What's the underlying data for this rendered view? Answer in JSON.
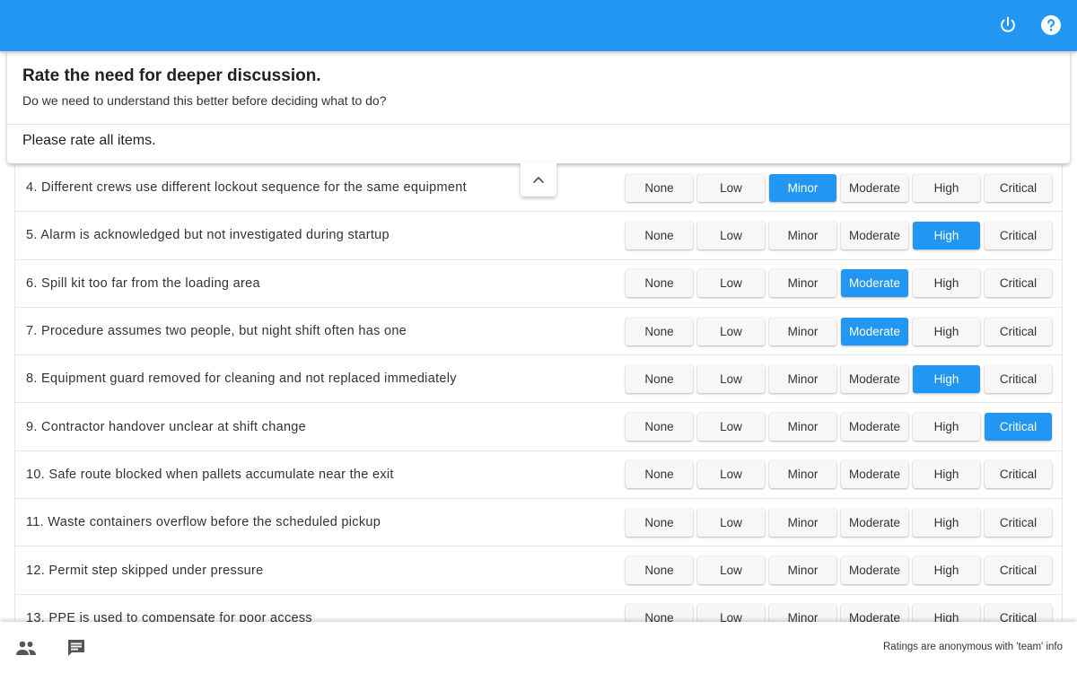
{
  "header": {
    "title": "Rate the need for deeper discussion.",
    "subtitle": "Do we need to understand this better before deciding what to do?",
    "notice": "Please rate all items."
  },
  "topbar": {
    "icons": [
      "power-icon",
      "help-icon"
    ]
  },
  "options": [
    "None",
    "Low",
    "Minor",
    "Moderate",
    "High",
    "Critical"
  ],
  "items": [
    {
      "label": "4. Different crews use different lockout sequence for the same equipment",
      "selected": "Minor"
    },
    {
      "label": "5. Alarm is acknowledged but not investigated during startup",
      "selected": "High"
    },
    {
      "label": "6. Spill kit too far from the loading area",
      "selected": "Moderate"
    },
    {
      "label": "7. Procedure assumes two people, but night shift often has one",
      "selected": "Moderate"
    },
    {
      "label": "8. Equipment guard removed for cleaning and not replaced immediately",
      "selected": "High"
    },
    {
      "label": "9. Contractor handover unclear at shift change",
      "selected": "Critical"
    },
    {
      "label": "10. Safe route blocked when pallets accumulate near the exit",
      "selected": ""
    },
    {
      "label": "11. Waste containers overflow before the scheduled pickup",
      "selected": ""
    },
    {
      "label": "12. Permit step skipped under pressure",
      "selected": ""
    },
    {
      "label": "13. PPE is used to compensate for poor access",
      "selected": ""
    }
  ],
  "footer": {
    "note": "Ratings are anonymous with 'team' info",
    "icons": [
      "team-icon",
      "chat-icon"
    ]
  },
  "colors": {
    "accent": "#2196f3",
    "selected_text": "#ffffff"
  }
}
